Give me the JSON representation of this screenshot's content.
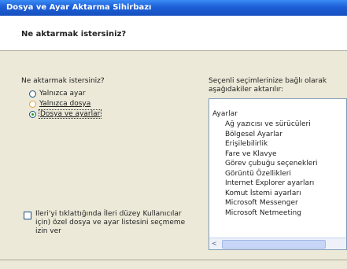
{
  "window": {
    "title": "Dosya ve Ayar Aktarma Sihirbazı"
  },
  "header": {
    "heading": "Ne aktarmak istersiniz?"
  },
  "question": "Ne aktarmak istersiniz?",
  "options": [
    {
      "label": "Yalnızca ayar",
      "selected": false
    },
    {
      "label": "Yalnızca dosya",
      "selected": false
    },
    {
      "label": "Dosya ve ayarlar",
      "selected": true
    }
  ],
  "note": "Seçenli seçimlerinize bağlı olarak aşağıdakiler aktarılır:",
  "list": {
    "group": "Ayarlar",
    "items": [
      "Ağ yazıcısı ve sürücüleri",
      "Bölgesel Ayarlar",
      "Erişilebilirlik",
      "Fare ve Klavye",
      "Görev çubuğu seçenekleri",
      "Görüntü Özellikleri",
      "Internet Explorer ayarları",
      "Komut İstemi ayarları",
      "Microsoft Messenger",
      "Microsoft Netmeeting"
    ]
  },
  "checkbox": {
    "label": "Ileri'yi tıklattığında İleri düzey Kullanıcılar için) özel dosya ve ayar listesini seçmeme izin ver",
    "checked": false
  },
  "scroll_arrow": "<"
}
